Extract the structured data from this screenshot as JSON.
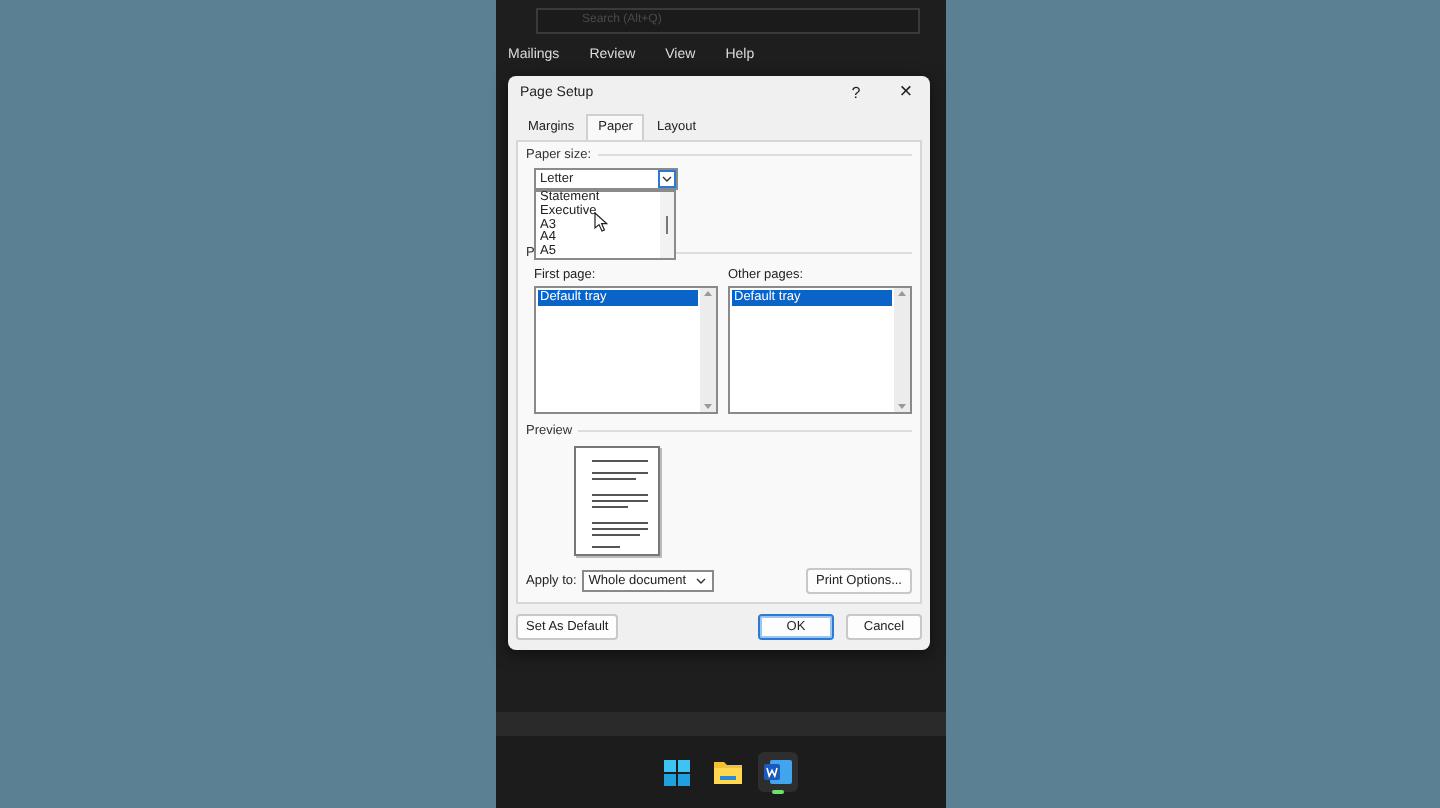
{
  "search": {
    "placeholder": "Search (Alt+Q)"
  },
  "ribbon_tabs": [
    "Mailings",
    "Review",
    "View",
    "Help"
  ],
  "dialog": {
    "title": "Page Setup",
    "help": "?",
    "close": "×",
    "tabs": [
      {
        "label": "Margins",
        "selected": false
      },
      {
        "label": "Paper",
        "selected": true
      },
      {
        "label": "Layout",
        "selected": false
      }
    ],
    "paper_size": {
      "label": "Paper size:",
      "value": "Letter",
      "expanded": true,
      "options": [
        "Statement",
        "Executive",
        "A3",
        "A4",
        "A5"
      ]
    },
    "paper_source": {
      "label": "P",
      "first_page": {
        "label": "First page:",
        "items": [
          {
            "text": "Default tray",
            "selected": true
          }
        ]
      },
      "other_pages": {
        "label": "Other pages:",
        "items": [
          {
            "text": "Default tray",
            "selected": true
          }
        ]
      }
    },
    "preview": {
      "label": "Preview"
    },
    "apply_to": {
      "label": "Apply to:",
      "value": "Whole document"
    },
    "print_options": "Print Options...",
    "buttons": [
      {
        "label": "Set As Default",
        "default": false
      },
      {
        "label": "OK",
        "default": true
      },
      {
        "label": "Cancel",
        "default": false
      }
    ]
  },
  "taskbar": [
    {
      "kind": "start",
      "active": false
    },
    {
      "kind": "explorer",
      "active": false
    },
    {
      "kind": "word",
      "active": true
    }
  ]
}
